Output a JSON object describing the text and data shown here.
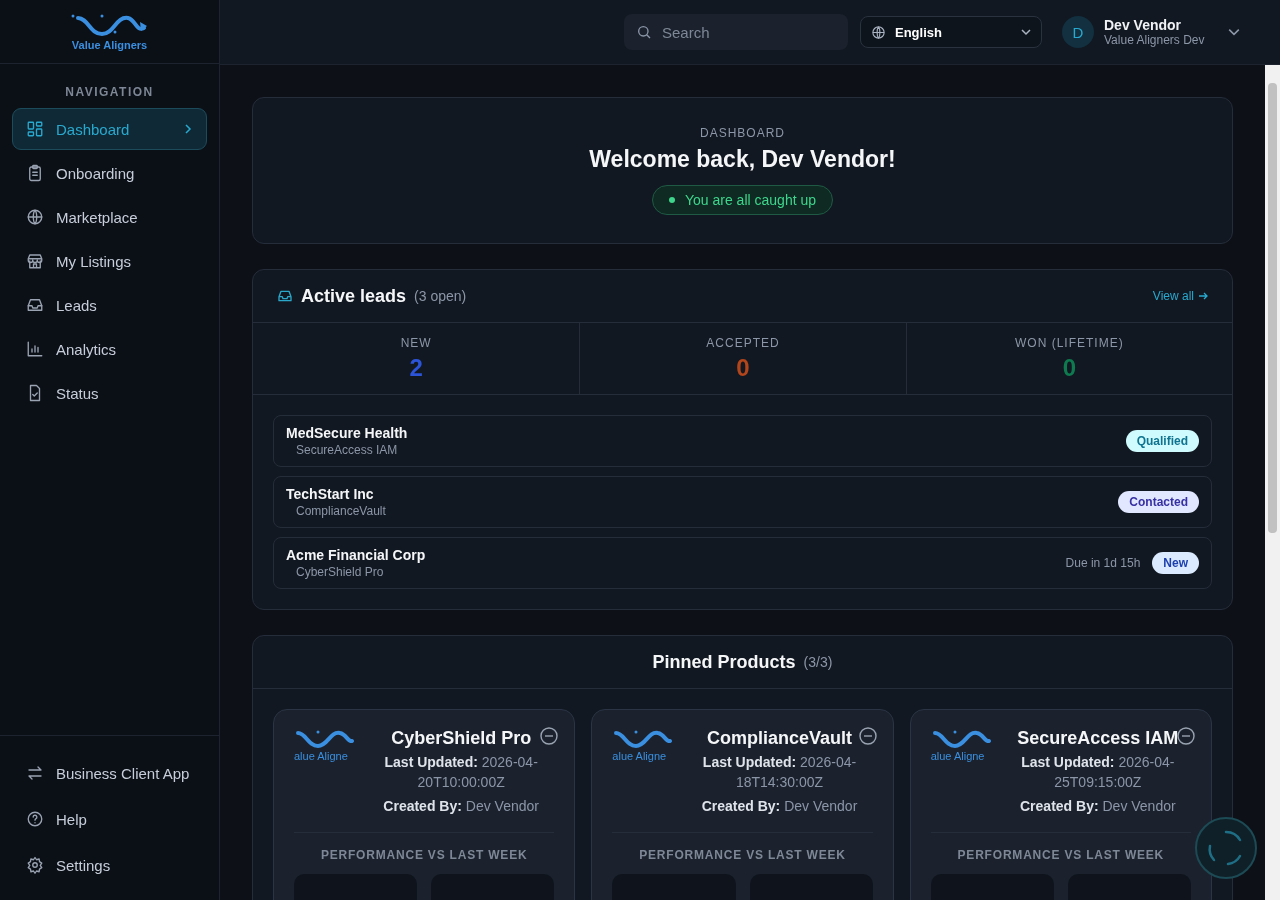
{
  "brand": {
    "name": "Value Aligners"
  },
  "sidebar": {
    "heading": "NAVIGATION",
    "items": [
      {
        "label": "Dashboard",
        "kind": "grid",
        "selected": true
      },
      {
        "label": "Onboarding",
        "kind": "clipboard",
        "selected": false
      },
      {
        "label": "Marketplace",
        "kind": "globe",
        "selected": false
      },
      {
        "label": "My Listings",
        "kind": "store",
        "selected": false
      },
      {
        "label": "Leads",
        "kind": "inbox",
        "selected": false
      },
      {
        "label": "Analytics",
        "kind": "chart",
        "selected": false
      },
      {
        "label": "Status",
        "kind": "file",
        "selected": false
      }
    ],
    "footer_items": [
      {
        "label": "Business Client App",
        "kind": "swap"
      },
      {
        "label": "Help",
        "kind": "help"
      },
      {
        "label": "Settings",
        "kind": "gear"
      }
    ]
  },
  "topbar": {
    "search": {
      "placeholder": "Search"
    },
    "language": "English",
    "user": {
      "initial": "D",
      "name": "Dev Vendor",
      "org": "Value Aligners Dev"
    }
  },
  "welcome": {
    "eyebrow": "DASHBOARD",
    "title": "Welcome back, Dev Vendor!",
    "status": "You are all caught up"
  },
  "leads": {
    "title": "Active leads",
    "count": "(3 open)",
    "view_all": "View all",
    "stats": [
      {
        "label": "NEW",
        "value": "2",
        "color": "#2b54d9"
      },
      {
        "label": "ACCEPTED",
        "value": "0",
        "color": "#b3451b"
      },
      {
        "label": "WON (LIFETIME)",
        "value": "0",
        "color": "#0e7a4f"
      }
    ],
    "rows": [
      {
        "company": "MedSecure Health",
        "product": "SecureAccess IAM",
        "status": "Qualified",
        "kind": "qualified"
      },
      {
        "company": "TechStart Inc",
        "product": "ComplianceVault",
        "status": "Contacted",
        "kind": "contacted"
      },
      {
        "company": "Acme Financial Corp",
        "product": "CyberShield Pro",
        "due": "Due in 1d 15h",
        "status": "New",
        "kind": "new"
      }
    ]
  },
  "pinned": {
    "title": "Pinned Products",
    "count": "(3/3)",
    "products": [
      {
        "name": "CyberShield Pro",
        "logo_text": "alue Aligne",
        "updated_label": "Last Updated:",
        "updated": "2026-04-20T10:00:00Z",
        "created_label": "Created By:",
        "created": "Dev Vendor",
        "section": "PERFORMANCE VS LAST WEEK"
      },
      {
        "name": "ComplianceVault",
        "logo_text": "alue Aligne",
        "updated_label": "Last Updated:",
        "updated": "2026-04-18T14:30:00Z",
        "created_label": "Created By:",
        "created": "Dev Vendor",
        "section": "PERFORMANCE VS LAST WEEK"
      },
      {
        "name": "SecureAccess IAM",
        "logo_text": "alue Aligne",
        "updated_label": "Last Updated:",
        "updated": "2026-04-25T09:15:00Z",
        "created_label": "Created By:",
        "created": "Dev Vendor",
        "section": "PERFORMANCE VS LAST WEEK"
      }
    ]
  }
}
